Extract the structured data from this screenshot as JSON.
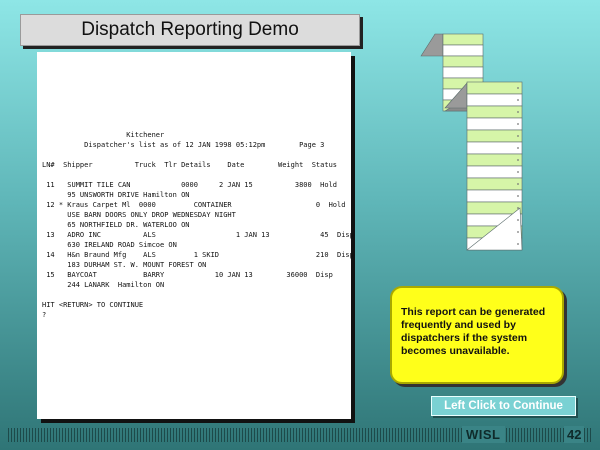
{
  "title": "Dispatch Reporting Demo",
  "report": {
    "lines": [
      "                    Kitchener",
      "          Dispatcher's list as of 12 JAN 1998 05:12pm        Page 3",
      "",
      "LN#  Shipper          Truck  Tlr Details    Date        Weight  Status",
      "",
      " 11   SUMMIT TILE CAN            0000     2 JAN 15          3800  Hold",
      "      95 UNSWORTH DRIVE Hamilton ON",
      " 12 * Kraus Carpet Ml  0000         CONTAINER                    0  Hold",
      "      USE BARN DOORS ONLY DROP WEDNESDAY NIGHT",
      "      65 NORTHFIELD DR. WATERLOO ON",
      " 13   ADRO INC          ALS                   1 JAN 13            45  Disp",
      "      630 IRELAND ROAD Simcoe ON",
      " 14   H&n Braund Mfg    ALS         1 SKID                       210  Disp",
      "      183 DURHAM ST. W. MOUNT FOREST ON",
      " 15   BAYCOAT           BARRY            10 JAN 13        36000  Disp",
      "      244 LANARK  Hamilton ON",
      "",
      "HIT <RETURN> TO CONTINUE",
      "?"
    ]
  },
  "callout": {
    "text": "This report can be generated frequently and used by dispatchers if the system becomes unavailable."
  },
  "continue_label": "Left Click to Continue",
  "footer": {
    "logo": "WISL",
    "page_number": "42"
  },
  "colors": {
    "paper_stripe": "#d6f5a8",
    "callout_fill": "#ffff1a",
    "background_top": "#8ee6e6",
    "background_bottom": "#2f7576"
  },
  "icons": {
    "printout": "continuous-form-paper-icon"
  }
}
